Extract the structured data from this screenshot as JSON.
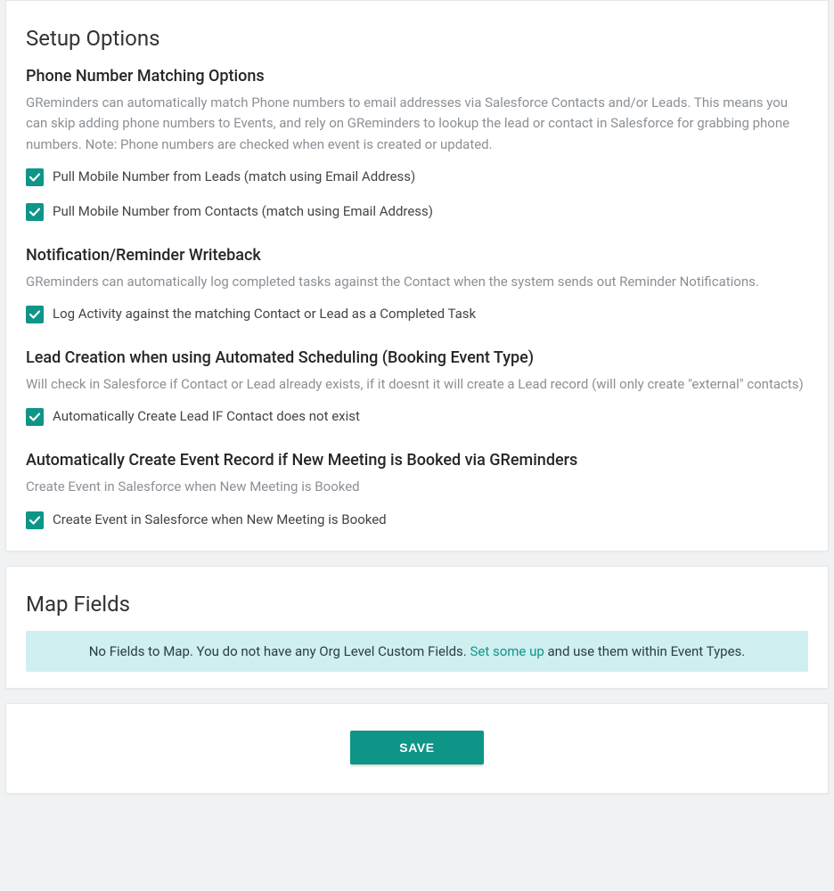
{
  "panel": {
    "title": "Setup Options",
    "sections": {
      "phone": {
        "title": "Phone Number Matching Options",
        "desc": "GReminders can automatically match Phone numbers to email addresses via Salesforce Contacts and/or Leads. This means you can skip adding phone numbers to Events, and rely on GReminders to lookup the lead or contact in Salesforce for grabbing phone numbers. Note: Phone numbers are checked when event is created or updated.",
        "chk1": "Pull Mobile Number from Leads (match using Email Address)",
        "chk2": "Pull Mobile Number from Contacts (match using Email Address)"
      },
      "writeback": {
        "title": "Notification/Reminder Writeback",
        "desc": "GReminders can automatically log completed tasks against the Contact when the system sends out Reminder Notifications.",
        "chk1": "Log Activity against the matching Contact or Lead as a Completed Task"
      },
      "lead": {
        "title": "Lead Creation when using Automated Scheduling (Booking Event Type)",
        "desc": "Will check in Salesforce if Contact or Lead already exists, if it doesnt it will create a Lead record (will only create \"external\" contacts)",
        "chk1": "Automatically Create Lead IF Contact does not exist"
      },
      "event": {
        "title": "Automatically Create Event Record if New Meeting is Booked via GReminders",
        "desc": "Create Event in Salesforce when New Meeting is Booked",
        "chk1": "Create Event in Salesforce when New Meeting is Booked"
      }
    }
  },
  "mapFields": {
    "title": "Map Fields",
    "info_pre": "No Fields to Map. You do not have any Org Level Custom Fields. ",
    "info_link": "Set some up",
    "info_post": " and use them within Event Types."
  },
  "actions": {
    "save": "SAVE"
  }
}
